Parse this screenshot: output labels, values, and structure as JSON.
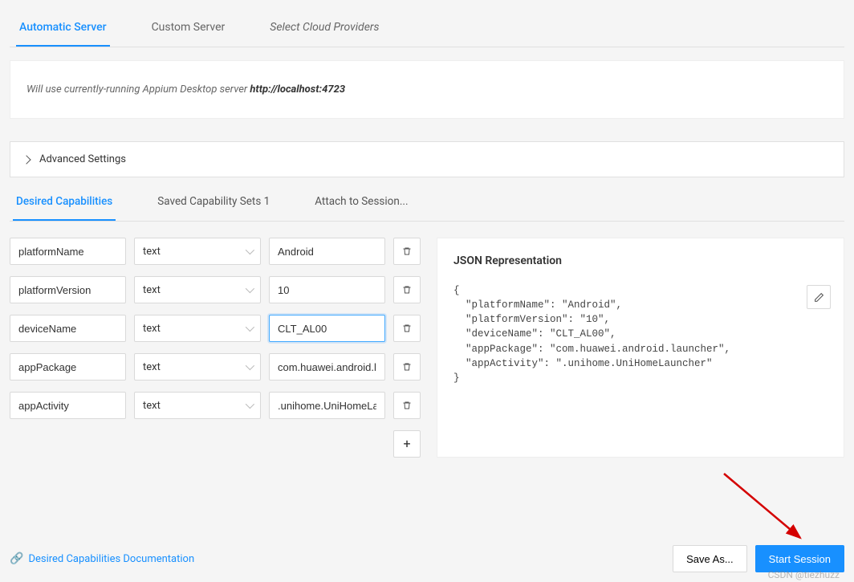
{
  "tabs": {
    "automatic": "Automatic Server",
    "custom": "Custom Server",
    "cloud": "Select Cloud Providers"
  },
  "info": {
    "prefix": "Will use currently-running Appium Desktop server ",
    "server_url": "http://localhost:4723"
  },
  "advanced_settings_label": "Advanced Settings",
  "sub_tabs": {
    "desired": "Desired Capabilities",
    "saved": "Saved Capability Sets 1",
    "attach": "Attach to Session..."
  },
  "type_option": "text",
  "caps": [
    {
      "name": "platformName",
      "value": "Android",
      "focused": false
    },
    {
      "name": "platformVersion",
      "value": "10",
      "focused": false
    },
    {
      "name": "deviceName",
      "value": "CLT_AL00",
      "focused": true
    },
    {
      "name": "appPackage",
      "value": "com.huawei.android.launcher",
      "focused": false,
      "display_value": "com.huawei.android.lau"
    },
    {
      "name": "appActivity",
      "value": ".unihome.UniHomeLauncher",
      "focused": false,
      "display_value": ".unihome.UniHomeLau"
    }
  ],
  "json_panel": {
    "title": "JSON Representation",
    "body": "{\n  \"platformName\": \"Android\",\n  \"platformVersion\": \"10\",\n  \"deviceName\": \"CLT_AL00\",\n  \"appPackage\": \"com.huawei.android.launcher\",\n  \"appActivity\": \".unihome.UniHomeLauncher\"\n}"
  },
  "footer": {
    "doc_link": "Desired Capabilities Documentation",
    "save_as": "Save As...",
    "start_session": "Start Session"
  },
  "watermark": "CSDN @tiezhuzz"
}
